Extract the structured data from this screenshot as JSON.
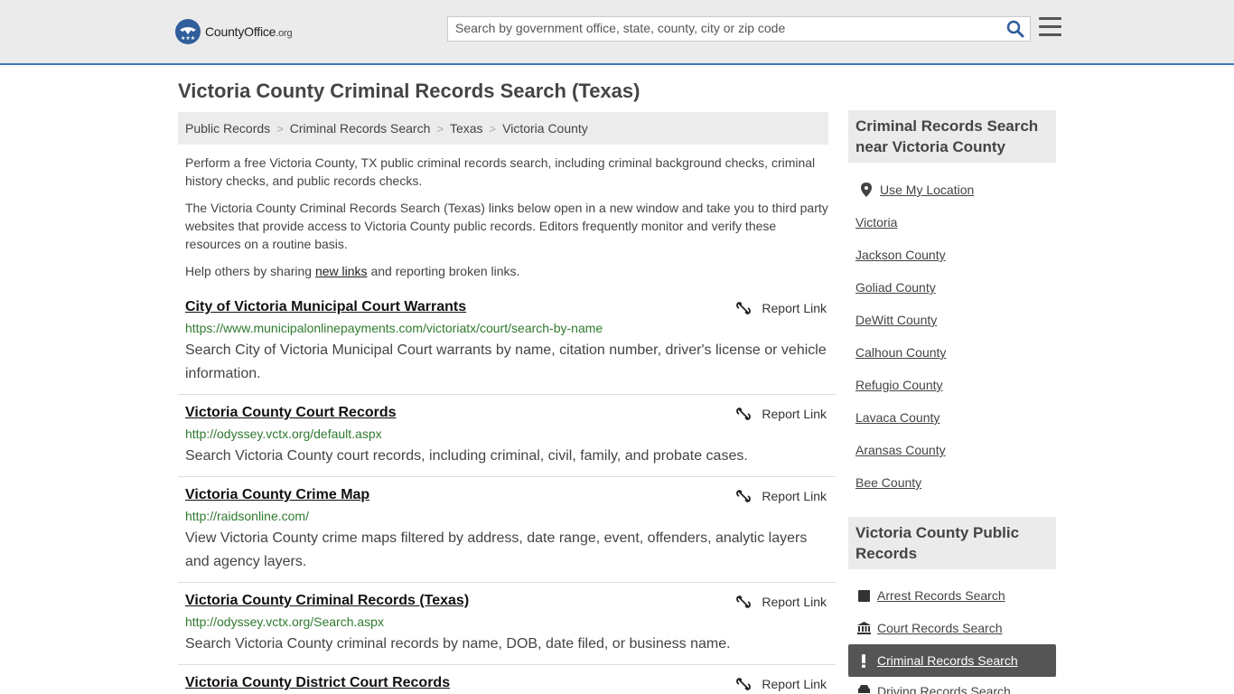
{
  "header": {
    "logo_main": "CountyOffice",
    "logo_tld": ".org",
    "search_placeholder": "Search by government office, state, county, city or zip code"
  },
  "page_title": "Victoria County Criminal Records Search (Texas)",
  "breadcrumb": [
    "Public Records",
    "Criminal Records Search",
    "Texas",
    "Victoria County"
  ],
  "intro": {
    "p1": "Perform a free Victoria County, TX public criminal records search, including criminal background checks, criminal history checks, and public records checks.",
    "p2": "The Victoria County Criminal Records Search (Texas) links below open in a new window and take you to third party websites that provide access to Victoria County public records. Editors frequently monitor and verify these resources on a routine basis.",
    "p3_before": "Help others by sharing ",
    "p3_link": "new links",
    "p3_after": " and reporting broken links."
  },
  "report_label": "Report Link",
  "listings": [
    {
      "title": "City of Victoria Municipal Court Warrants",
      "url": "https://www.municipalonlinepayments.com/victoriatx/court/search-by-name",
      "desc": "Search City of Victoria Municipal Court warrants by name, citation number, driver's license or vehicle information."
    },
    {
      "title": "Victoria County Court Records",
      "url": "http://odyssey.vctx.org/default.aspx",
      "desc": "Search Victoria County court records, including criminal, civil, family, and probate cases."
    },
    {
      "title": "Victoria County Crime Map",
      "url": "http://raidsonline.com/",
      "desc": "View Victoria County crime maps filtered by address, date range, event, offenders, analytic layers and agency layers."
    },
    {
      "title": "Victoria County Criminal Records (Texas)",
      "url": "http://odyssey.vctx.org/Search.aspx",
      "desc": "Search Victoria County criminal records by name, DOB, date filed, or business name."
    },
    {
      "title": "Victoria County District Court Records",
      "url": "",
      "desc": ""
    }
  ],
  "sidebar": {
    "nearby_heading": "Criminal Records Search near Victoria County",
    "use_location": "Use My Location",
    "nearby": [
      "Victoria",
      "Jackson County",
      "Goliad County",
      "DeWitt County",
      "Calhoun County",
      "Refugio County",
      "Lavaca County",
      "Aransas County",
      "Bee County"
    ],
    "public_heading": "Victoria County Public Records",
    "public_links": [
      {
        "label": "Arrest Records Search",
        "icon": "square-icon"
      },
      {
        "label": "Court Records Search",
        "icon": "courthouse-icon"
      },
      {
        "label": "Criminal Records Search",
        "icon": "exclamation-icon"
      },
      {
        "label": "Driving Records Search",
        "icon": "car-icon"
      }
    ]
  },
  "colors": {
    "accent": "#3d77b8",
    "url_green": "#2f7a2f",
    "active_bg": "#555555"
  }
}
